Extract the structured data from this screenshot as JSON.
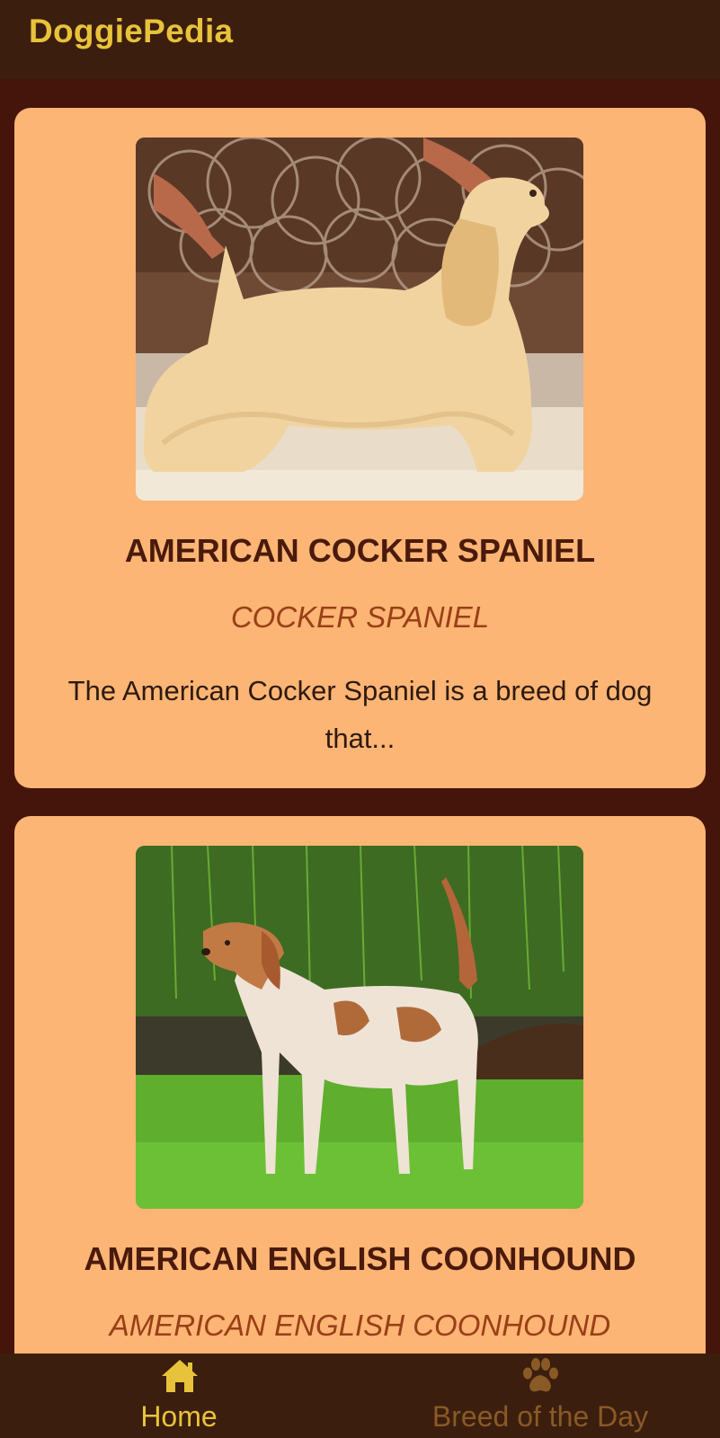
{
  "app": {
    "title": "DoggiePedia"
  },
  "colors": {
    "app_bar": "#3b1e0e",
    "background": "#45140b",
    "card": "#fcb574",
    "accent": "#e8c23a",
    "inactive_nav": "#8a5a26"
  },
  "breeds": [
    {
      "name": "AMERICAN COCKER SPANIEL",
      "alt_name": "COCKER SPANIEL",
      "description": "The American Cocker Spaniel is a breed of dog that...",
      "image": "photo of a cream-colored cocker spaniel being shown"
    },
    {
      "name": "AMERICAN ENGLISH COONHOUND",
      "alt_name": "AMERICAN ENGLISH COONHOUND",
      "description": "",
      "image": "photo of a red-ticked coonhound standing on grass"
    }
  ],
  "bottom_nav": {
    "items": [
      {
        "label": "Home",
        "icon": "home-icon",
        "active": true
      },
      {
        "label": "Breed of the Day",
        "icon": "paw-icon",
        "active": false
      }
    ]
  }
}
